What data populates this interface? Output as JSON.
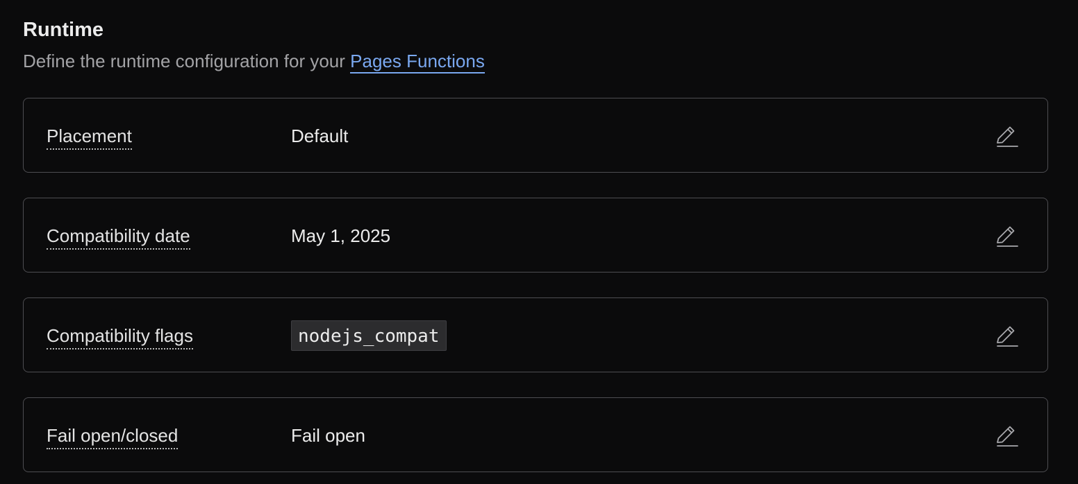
{
  "section": {
    "title": "Runtime",
    "subtitle_prefix": "Define the runtime configuration for your",
    "subtitle_link": "Pages Functions"
  },
  "settings": [
    {
      "label": "Placement",
      "value": "Default",
      "edit_icon": "pencil-icon"
    },
    {
      "label": "Compatibility date",
      "value": "May 1, 2025",
      "edit_icon": "pencil-icon"
    },
    {
      "label": "Compatibility flags",
      "value": "nodejs_compat",
      "edit_icon": "pencil-icon"
    },
    {
      "label": "Fail open/closed",
      "value": "Fail open",
      "edit_icon": "pencil-icon"
    }
  ],
  "colors": {
    "background": "#0b0b0c",
    "link": "#7aa8f0",
    "border": "#4e4e52",
    "code_bg": "#2c2c2e"
  }
}
